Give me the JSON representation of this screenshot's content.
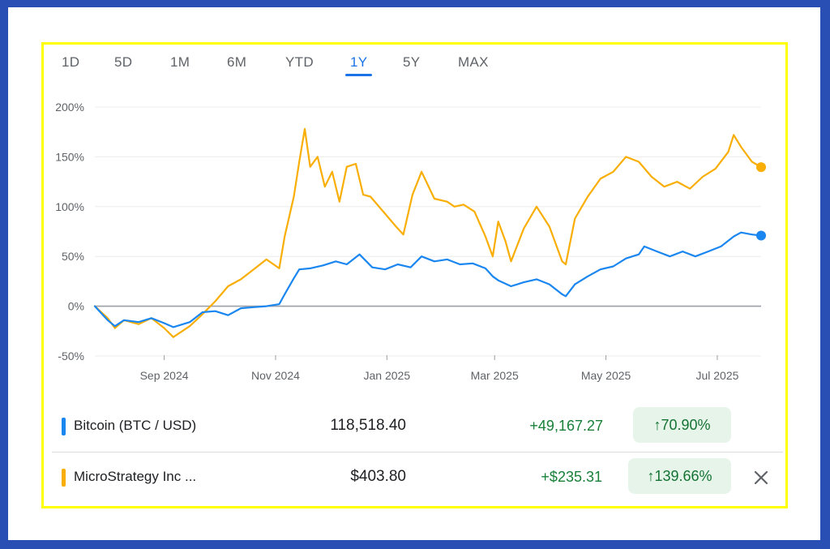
{
  "tabs": [
    "1D",
    "5D",
    "1M",
    "6M",
    "YTD",
    "1Y",
    "5Y",
    "MAX"
  ],
  "active_tab": "1Y",
  "colors": {
    "btc": "#1a86f0",
    "mstr": "#f9ae05",
    "positive": "#188038",
    "positive_bg": "#e6f4ea",
    "accent": "#1a73e8"
  },
  "chart_data": {
    "type": "line",
    "y_ticks": [
      "200%",
      "150%",
      "100%",
      "50%",
      "0%",
      "-50%"
    ],
    "ylim": [
      -50,
      200
    ],
    "x_ticks": [
      "Sep 2024",
      "Nov 2024",
      "Jan 2025",
      "Mar 2025",
      "May 2025",
      "Jul 2025"
    ],
    "x_range": [
      "2024-07-25",
      "2025-07-25"
    ],
    "grid": true,
    "series": [
      {
        "name": "Bitcoin (BTC / USD)",
        "color": "#1a86f0",
        "points": [
          [
            "2024-07-25",
            0
          ],
          [
            "2024-08-01",
            -14
          ],
          [
            "2024-08-05",
            -20
          ],
          [
            "2024-08-10",
            -14
          ],
          [
            "2024-08-18",
            -16
          ],
          [
            "2024-08-25",
            -12
          ],
          [
            "2024-09-01",
            -17
          ],
          [
            "2024-09-06",
            -21
          ],
          [
            "2024-09-15",
            -16
          ],
          [
            "2024-09-22",
            -6
          ],
          [
            "2024-09-29",
            -5
          ],
          [
            "2024-10-06",
            -9
          ],
          [
            "2024-10-13",
            -2
          ],
          [
            "2024-10-20",
            -1
          ],
          [
            "2024-10-27",
            0
          ],
          [
            "2024-11-03",
            2
          ],
          [
            "2024-11-06",
            12
          ],
          [
            "2024-11-11",
            28
          ],
          [
            "2024-11-14",
            37
          ],
          [
            "2024-11-20",
            38
          ],
          [
            "2024-11-27",
            41
          ],
          [
            "2024-12-04",
            45
          ],
          [
            "2024-12-10",
            42
          ],
          [
            "2024-12-17",
            52
          ],
          [
            "2024-12-24",
            39
          ],
          [
            "2024-12-31",
            37
          ],
          [
            "2025-01-07",
            42
          ],
          [
            "2025-01-14",
            39
          ],
          [
            "2025-01-20",
            50
          ],
          [
            "2025-01-27",
            45
          ],
          [
            "2025-02-03",
            47
          ],
          [
            "2025-02-10",
            42
          ],
          [
            "2025-02-17",
            43
          ],
          [
            "2025-02-24",
            38
          ],
          [
            "2025-02-28",
            30
          ],
          [
            "2025-03-03",
            26
          ],
          [
            "2025-03-10",
            20
          ],
          [
            "2025-03-17",
            24
          ],
          [
            "2025-03-24",
            27
          ],
          [
            "2025-03-31",
            22
          ],
          [
            "2025-04-07",
            12
          ],
          [
            "2025-04-09",
            10
          ],
          [
            "2025-04-14",
            22
          ],
          [
            "2025-04-21",
            30
          ],
          [
            "2025-04-28",
            37
          ],
          [
            "2025-05-05",
            40
          ],
          [
            "2025-05-12",
            48
          ],
          [
            "2025-05-19",
            52
          ],
          [
            "2025-05-22",
            60
          ],
          [
            "2025-05-29",
            55
          ],
          [
            "2025-06-05",
            50
          ],
          [
            "2025-06-12",
            55
          ],
          [
            "2025-06-19",
            50
          ],
          [
            "2025-06-26",
            55
          ],
          [
            "2025-07-03",
            60
          ],
          [
            "2025-07-10",
            70
          ],
          [
            "2025-07-14",
            74
          ],
          [
            "2025-07-20",
            72
          ],
          [
            "2025-07-25",
            70.9
          ]
        ]
      },
      {
        "name": "MicroStrategy Inc ...",
        "color": "#f9ae05",
        "points": [
          [
            "2024-07-25",
            0
          ],
          [
            "2024-08-01",
            -12
          ],
          [
            "2024-08-05",
            -22
          ],
          [
            "2024-08-10",
            -14
          ],
          [
            "2024-08-18",
            -18
          ],
          [
            "2024-08-25",
            -12
          ],
          [
            "2024-09-01",
            -22
          ],
          [
            "2024-09-06",
            -31
          ],
          [
            "2024-09-15",
            -20
          ],
          [
            "2024-09-22",
            -8
          ],
          [
            "2024-09-29",
            5
          ],
          [
            "2024-10-06",
            20
          ],
          [
            "2024-10-13",
            27
          ],
          [
            "2024-10-20",
            37
          ],
          [
            "2024-10-27",
            47
          ],
          [
            "2024-11-03",
            38
          ],
          [
            "2024-11-06",
            70
          ],
          [
            "2024-11-11",
            110
          ],
          [
            "2024-11-14",
            145
          ],
          [
            "2024-11-17",
            178
          ],
          [
            "2024-11-20",
            140
          ],
          [
            "2024-11-24",
            150
          ],
          [
            "2024-11-28",
            120
          ],
          [
            "2024-12-02",
            135
          ],
          [
            "2024-12-06",
            105
          ],
          [
            "2024-12-10",
            140
          ],
          [
            "2024-12-15",
            143
          ],
          [
            "2024-12-19",
            112
          ],
          [
            "2024-12-23",
            110
          ],
          [
            "2024-12-30",
            95
          ],
          [
            "2025-01-06",
            80
          ],
          [
            "2025-01-10",
            72
          ],
          [
            "2025-01-15",
            112
          ],
          [
            "2025-01-20",
            135
          ],
          [
            "2025-01-27",
            108
          ],
          [
            "2025-02-03",
            105
          ],
          [
            "2025-02-07",
            100
          ],
          [
            "2025-02-12",
            102
          ],
          [
            "2025-02-18",
            95
          ],
          [
            "2025-02-24",
            70
          ],
          [
            "2025-02-28",
            50
          ],
          [
            "2025-03-03",
            85
          ],
          [
            "2025-03-07",
            65
          ],
          [
            "2025-03-10",
            45
          ],
          [
            "2025-03-17",
            78
          ],
          [
            "2025-03-24",
            100
          ],
          [
            "2025-03-31",
            80
          ],
          [
            "2025-04-04",
            60
          ],
          [
            "2025-04-07",
            45
          ],
          [
            "2025-04-09",
            42
          ],
          [
            "2025-04-14",
            88
          ],
          [
            "2025-04-21",
            110
          ],
          [
            "2025-04-28",
            128
          ],
          [
            "2025-05-05",
            135
          ],
          [
            "2025-05-12",
            150
          ],
          [
            "2025-05-19",
            145
          ],
          [
            "2025-05-26",
            130
          ],
          [
            "2025-06-02",
            120
          ],
          [
            "2025-06-09",
            125
          ],
          [
            "2025-06-16",
            118
          ],
          [
            "2025-06-23",
            130
          ],
          [
            "2025-06-30",
            138
          ],
          [
            "2025-07-07",
            155
          ],
          [
            "2025-07-10",
            172
          ],
          [
            "2025-07-14",
            160
          ],
          [
            "2025-07-20",
            145
          ],
          [
            "2025-07-25",
            139.66
          ]
        ]
      }
    ]
  },
  "rows": [
    {
      "name": "Bitcoin (BTC / USD)",
      "price": "118,518.40",
      "change": "+49,167.27",
      "pct": "70.90%"
    },
    {
      "name": "MicroStrategy Inc ...",
      "price": "$403.80",
      "change": "+$235.31",
      "pct": "139.66%"
    }
  ]
}
